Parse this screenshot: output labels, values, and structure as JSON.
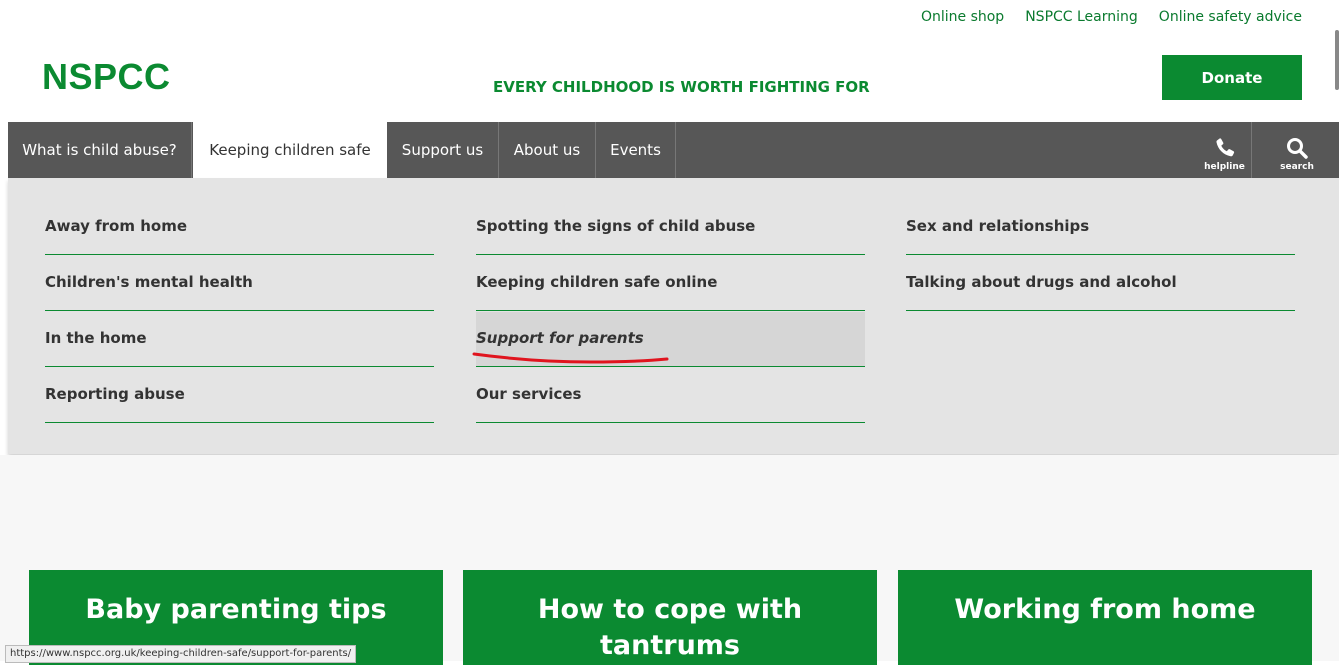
{
  "utility_links": [
    "Online shop",
    "NSPCC Learning",
    "Online safety advice"
  ],
  "logo": "NSPCC",
  "tagline": "EVERY CHILDHOOD IS WORTH FIGHTING FOR",
  "donate_label": "Donate",
  "nav": {
    "items": [
      "What is child abuse?",
      "Keeping children safe",
      "Support us",
      "About us",
      "Events"
    ],
    "active": "Keeping children safe",
    "helpline_label": "helpline",
    "search_label": "search"
  },
  "dropdown": {
    "col1": [
      "Away from home",
      "Children's mental health",
      "In the home",
      "Reporting abuse"
    ],
    "col2": [
      "Spotting the signs of child abuse",
      "Keeping children safe online",
      "Support for parents",
      "Our services"
    ],
    "col3": [
      "Sex and relationships",
      "Talking about drugs and alcohol"
    ],
    "hovered": "Support for parents",
    "annotation_color": "#e0141e"
  },
  "cards": [
    "Baby parenting tips",
    "How to cope with tantrums",
    "Working from home"
  ],
  "status_url": "https://www.nspcc.org.uk/keeping-children-safe/support-for-parents/",
  "colors": {
    "brand_green": "#0b8a31",
    "nav_grey": "#575757",
    "dropdown_bg": "#e4e4e4"
  }
}
